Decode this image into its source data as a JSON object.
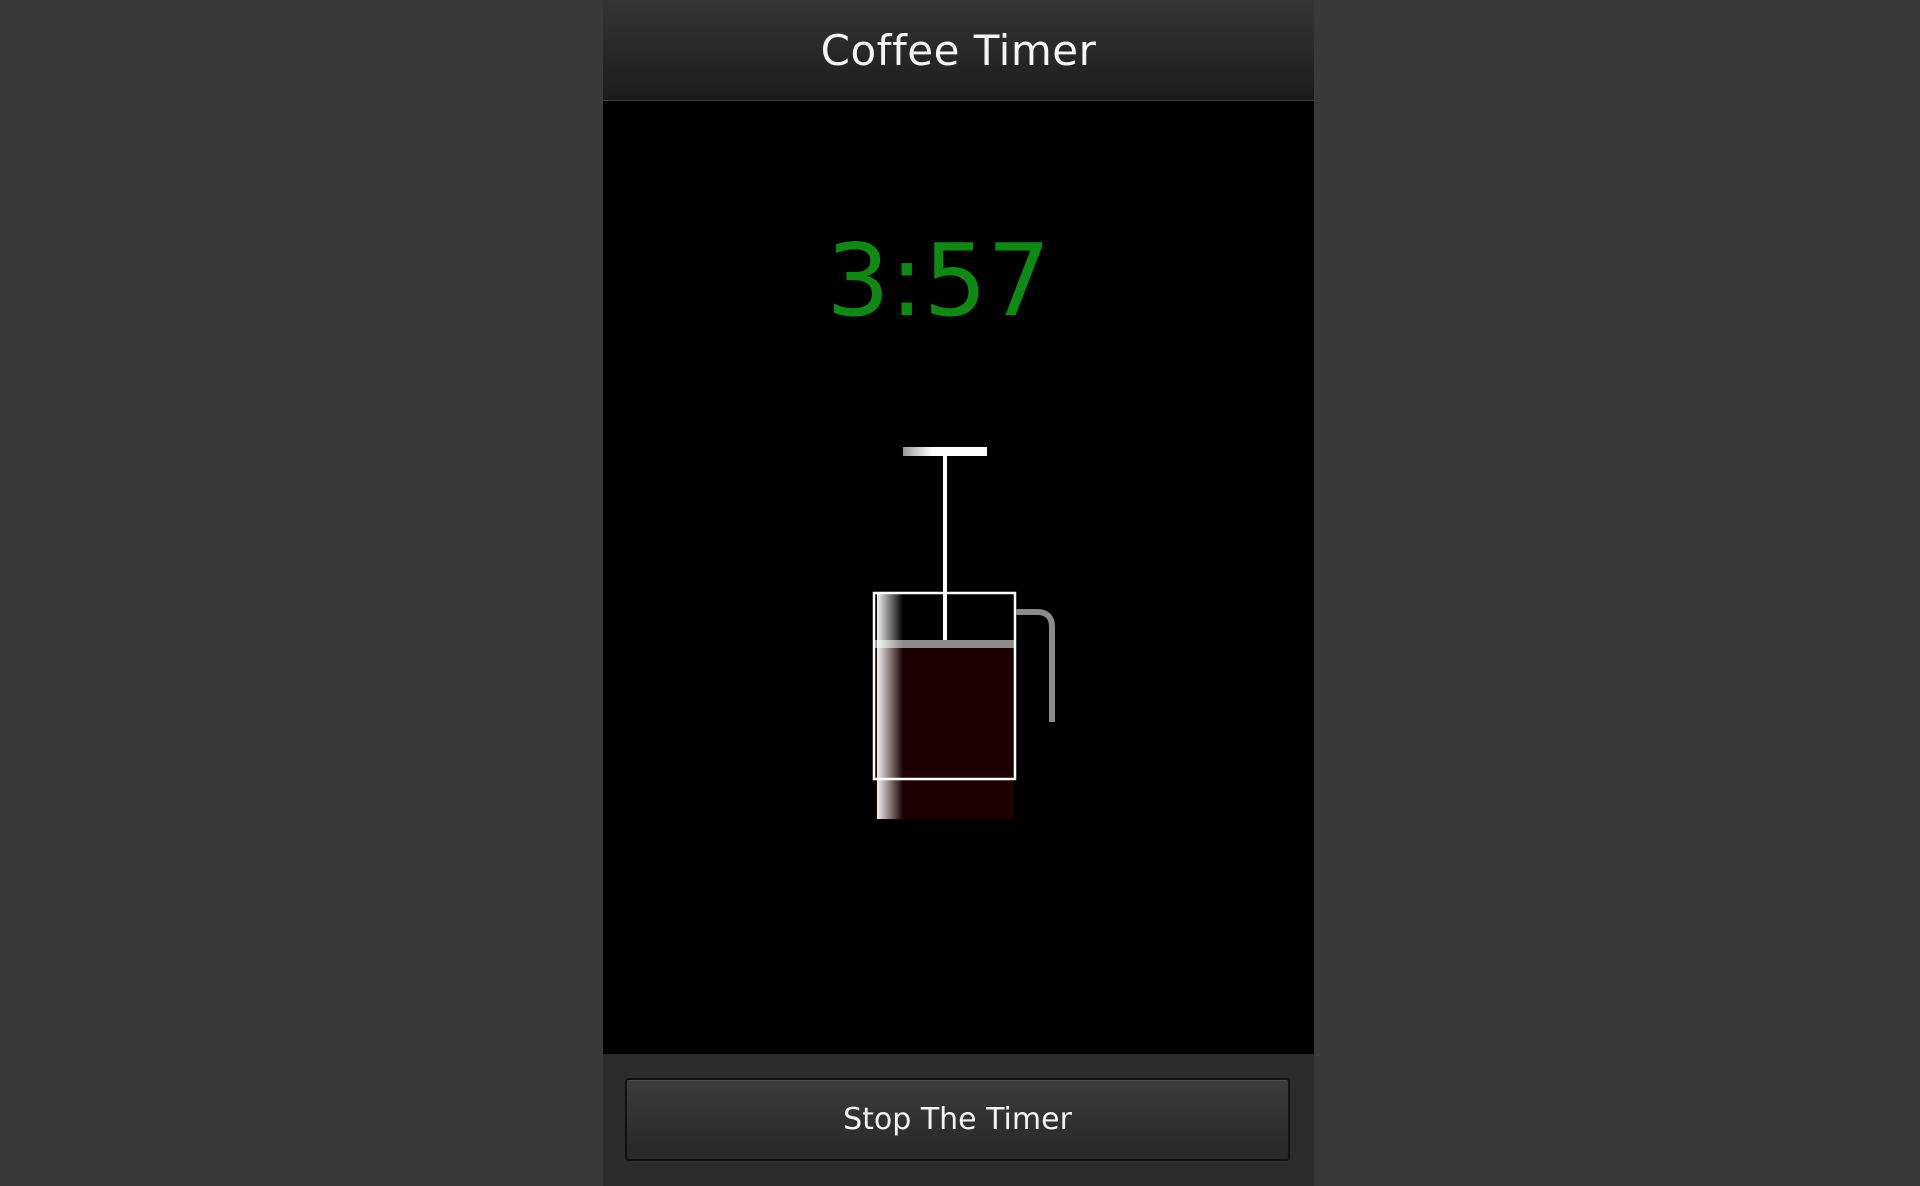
{
  "app": {
    "title": "Coffee Timer"
  },
  "timer": {
    "display": "3:57",
    "color": "#0d8a12"
  },
  "illustration": {
    "icon": "french-press-icon",
    "coffee_color": "#1c0000"
  },
  "actions": {
    "stop_label": "Stop The Timer"
  }
}
